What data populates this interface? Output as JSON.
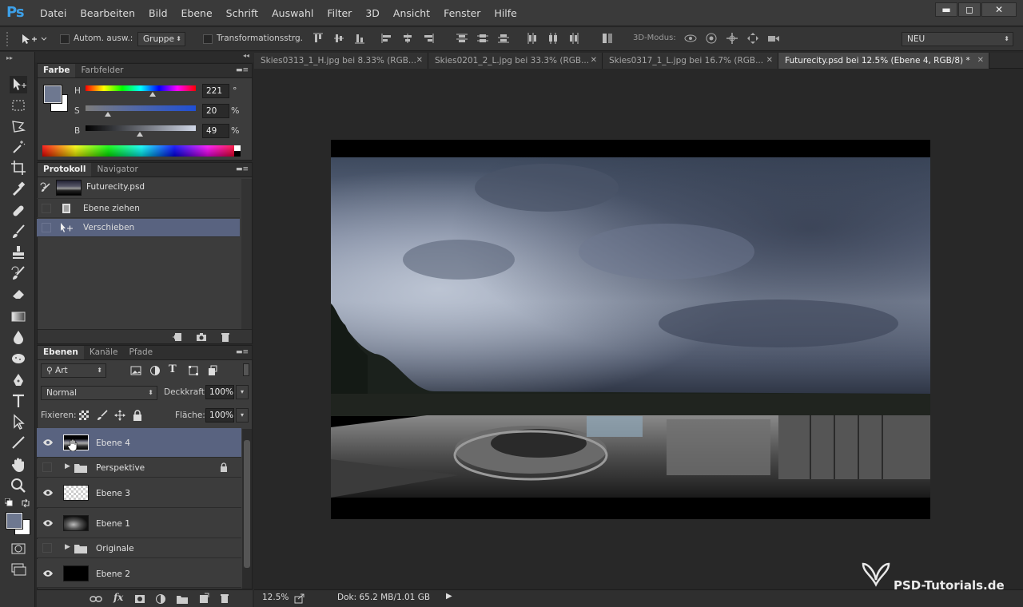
{
  "app": {
    "logo": "Ps"
  },
  "menu": [
    "Datei",
    "Bearbeiten",
    "Bild",
    "Ebene",
    "Schrift",
    "Auswahl",
    "Filter",
    "3D",
    "Ansicht",
    "Fenster",
    "Hilfe"
  ],
  "window_controls": {
    "minimize": "▬",
    "restore": "◻",
    "close": "✕"
  },
  "options": {
    "auto_select_label": "Autom. ausw.:",
    "auto_select_value": "Gruppe",
    "transform_label": "Transformationsstrg.",
    "mode3d_label": "3D-Modus:",
    "workspace": "NEU"
  },
  "color_panel": {
    "tabs": [
      "Farbe",
      "Farbfelder"
    ],
    "h": {
      "label": "H",
      "value": "221",
      "unit": "°",
      "pos": 0.61
    },
    "s": {
      "label": "S",
      "value": "20",
      "unit": "%",
      "pos": 0.2
    },
    "b": {
      "label": "B",
      "value": "49",
      "unit": "%",
      "pos": 0.49
    },
    "fg_color": "#6e7890",
    "bg_color": "#ffffff"
  },
  "history_panel": {
    "tabs": [
      "Protokoll",
      "Navigator"
    ],
    "snapshot": "Futurecity.psd",
    "items": [
      "Ebene ziehen",
      "Verschieben"
    ]
  },
  "layers_panel": {
    "tabs": [
      "Ebenen",
      "Kanäle",
      "Pfade"
    ],
    "filter": "Art",
    "blend_mode": "Normal",
    "opacity_label": "Deckkraft:",
    "opacity_value": "100%",
    "lock_label": "Fixieren:",
    "fill_label": "Fläche:",
    "fill_value": "100%",
    "layers": [
      {
        "name": "Ebene 4"
      },
      {
        "name": "Perspektive"
      },
      {
        "name": "Ebene 3"
      },
      {
        "name": "Ebene 1"
      },
      {
        "name": "Originale"
      },
      {
        "name": "Ebene 2"
      }
    ]
  },
  "doc_tabs": [
    {
      "label": "Skies0313_1_H.jpg bei 8.33% (RGB..."
    },
    {
      "label": "Skies0201_2_L.jpg bei 33.3% (RGB..."
    },
    {
      "label": "Skies0317_1_L.jpg bei 16.7% (RGB..."
    },
    {
      "label": "Futurecity.psd bei 12.5% (Ebene 4, RGB/8) *"
    }
  ],
  "status": {
    "zoom": "12.5%",
    "doc": "Dok: 65.2 MB/1.01 GB"
  },
  "watermark": "PSD-Tutorials.de"
}
